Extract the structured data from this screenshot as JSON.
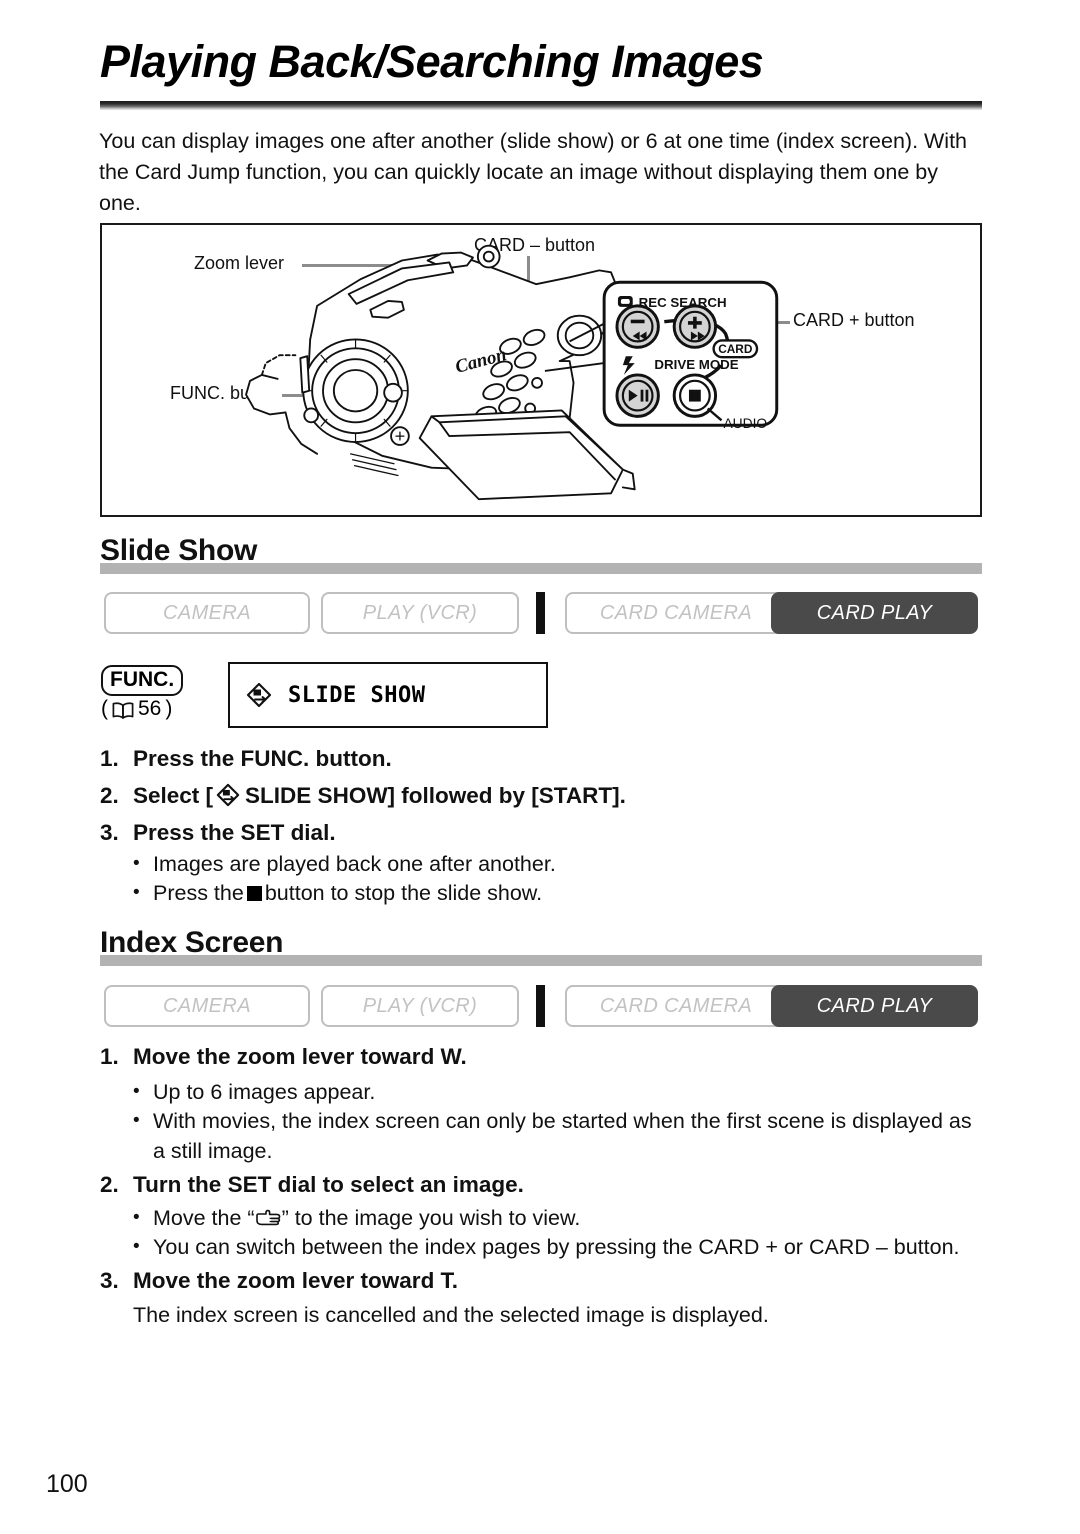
{
  "page": {
    "title": "Playing Back/Searching Images",
    "intro": "You can display images one after another (slide show) or 6 at one time (index screen). With the Card Jump function, you can quickly locate an image without displaying them one by one.",
    "folio": "100"
  },
  "diagram": {
    "labels": {
      "zoom_lever": "Zoom lever",
      "func_button": "FUNC. button",
      "card_minus": "CARD – button",
      "card_plus": "CARD + button"
    },
    "panel": {
      "rec_search": "REC SEARCH",
      "drive_mode": "DRIVE MODE",
      "card": "CARD",
      "audio": "AUDIO",
      "minus": "–",
      "plus": "+"
    },
    "brand": "Canon"
  },
  "modes": {
    "camera": "CAMERA",
    "play_vcr": "PLAY (VCR)",
    "card_camera": "CARD CAMERA",
    "card_play": "CARD PLAY",
    "active_color": "#4a4a4a",
    "inactive_color": "#c2c2c2"
  },
  "slide_show": {
    "heading": "Slide Show",
    "func_label": "FUNC.",
    "page_ref": "56",
    "page_ref_open": "(",
    "page_ref_close": ")",
    "menu_item": "SLIDE SHOW",
    "steps": [
      {
        "num": "1.",
        "text": "Press the FUNC. button."
      },
      {
        "num": "2.",
        "pre": "Select [",
        "icon": "slide-show-icon",
        "post": "SLIDE SHOW] followed by [START]."
      },
      {
        "num": "3.",
        "text": "Press the SET dial."
      }
    ],
    "bullets": [
      {
        "text": "Images are played back one after another."
      },
      {
        "pre": "Press the",
        "icon": "stop-square-icon",
        "post": "button to stop the slide show."
      }
    ]
  },
  "index_screen": {
    "heading": "Index Screen",
    "steps": [
      {
        "num": "1.",
        "text": "Move the zoom lever toward W."
      },
      {
        "num": "2.",
        "text": "Turn the SET dial to select an image."
      },
      {
        "num": "3.",
        "text": "Move the zoom lever toward T."
      }
    ],
    "bullets_1": [
      "Up to 6 images appear.",
      "With movies, the index screen can only be started when the first scene is displayed as a still image."
    ],
    "bullets_2_pre": "Move the “",
    "bullets_2_post": "” to the image you wish to view.",
    "bullets_2b": "You can switch between the index pages by pressing the CARD + or CARD – button.",
    "step3_note": "The index screen is cancelled and the selected image is displayed."
  }
}
